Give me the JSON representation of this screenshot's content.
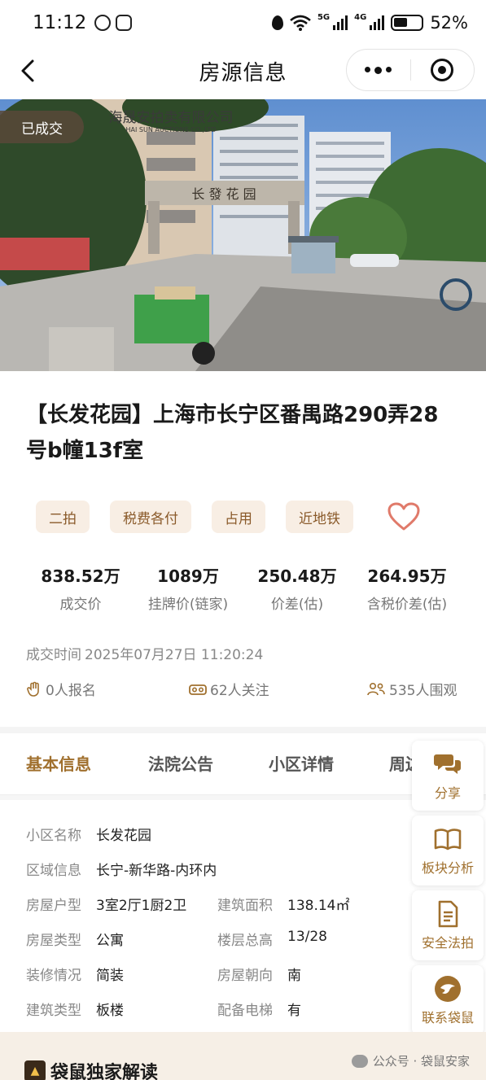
{
  "status_bar": {
    "time": "11:12",
    "network_1": "5G",
    "network_2": "4G",
    "battery": "52%"
  },
  "nav": {
    "title": "房源信息"
  },
  "hero": {
    "badge": "已成交",
    "sign_text": "长 發 花 园",
    "banner_text": "海晟安拍卖有限公司",
    "banner_sub": "HAI SUN AUCTIONS CO.,LTD"
  },
  "listing": {
    "title": "【长发花园】上海市长宁区番禺路290弄28号b幢13f室",
    "tags": [
      "二拍",
      "税费各付",
      "占用",
      "近地铁"
    ],
    "stats": [
      {
        "value": "838.52万",
        "label": "成交价"
      },
      {
        "value": "1089万",
        "label": "挂牌价(链家)"
      },
      {
        "value": "250.48万",
        "label": "价差(估)"
      },
      {
        "value": "264.95万",
        "label": "含税价差(估)"
      }
    ],
    "deal_time_label": "成交时间",
    "deal_time_value": "2025年07月27日 11:20:24",
    "counts": {
      "signups": "0人报名",
      "follows": "62人关注",
      "views": "535人围观"
    }
  },
  "tabs": [
    "基本信息",
    "法院公告",
    "小区详情",
    "周边"
  ],
  "info": {
    "community_label": "小区名称",
    "community": "长发花园",
    "region_label": "区域信息",
    "region": "长宁-新华路-内环内",
    "layout_label": "房屋户型",
    "layout": "3室2厅1厨2卫",
    "area_label": "建筑面积",
    "area": "138.14㎡",
    "type_label": "房屋类型",
    "type": "公寓",
    "floor_label": "楼层总高",
    "floor": "13/28",
    "deco_label": "装修情况",
    "deco": "简装",
    "orient_label": "房屋朝向",
    "orient": "南",
    "building_label": "建筑类型",
    "building": "板楼",
    "elevator_label": "配备电梯",
    "elevator": "有"
  },
  "side_buttons": [
    "分享",
    "板块分析",
    "安全法拍",
    "联系袋鼠"
  ],
  "bottom": {
    "section_title": "袋鼠独家解读",
    "watermark": "公众号 · 袋鼠安家"
  },
  "colors": {
    "accent": "#a0702e",
    "tag_bg": "#f8eee4",
    "heart": "#e07a6a"
  }
}
